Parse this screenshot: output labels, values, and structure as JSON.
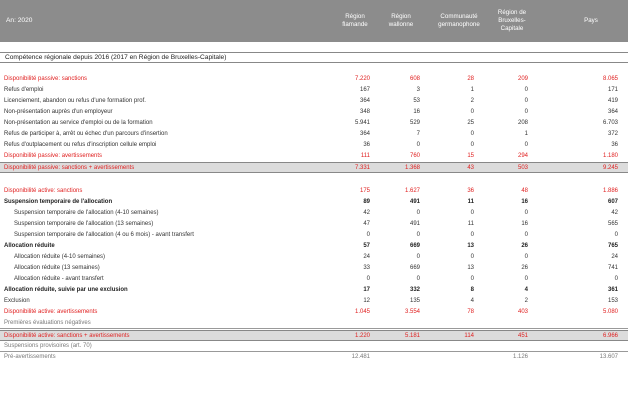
{
  "header": {
    "year_label": "An: 2020",
    "columns": [
      "Région\nflamande",
      "Région\nwallonne",
      "Communauté\ngermanophone",
      "Région de\nBruxelles-\nCapitale",
      "Pays"
    ]
  },
  "section_title": "Compétence régionale depuis 2016 (2017 en Région de Bruxelles-Capitale)",
  "rows": [
    {
      "label": "Disponibilité passive: sanctions",
      "vals": [
        "7.220",
        "608",
        "28",
        "209",
        "8.065"
      ],
      "style": "red"
    },
    {
      "label": "Refus d'emploi",
      "vals": [
        "167",
        "3",
        "1",
        "0",
        "171"
      ],
      "style": ""
    },
    {
      "label": "Licenciement, abandon ou refus d'une formation prof.",
      "vals": [
        "364",
        "53",
        "2",
        "0",
        "419"
      ],
      "style": ""
    },
    {
      "label": "Non-présentation auprès d'un employeur",
      "vals": [
        "348",
        "16",
        "0",
        "0",
        "364"
      ],
      "style": ""
    },
    {
      "label": "Non-présentation au service d'emploi ou de la formation",
      "vals": [
        "5.941",
        "529",
        "25",
        "208",
        "6.703"
      ],
      "style": ""
    },
    {
      "label": "Refus de participer à, arrêt ou échec d'un parcours d'insertion",
      "vals": [
        "364",
        "7",
        "0",
        "1",
        "372"
      ],
      "style": ""
    },
    {
      "label": "Refus d'outplacement ou refus d'inscription cellule emploi",
      "vals": [
        "36",
        "0",
        "0",
        "0",
        "36"
      ],
      "style": ""
    },
    {
      "label": "Disponibilité passive: avertissements",
      "vals": [
        "111",
        "760",
        "15",
        "294",
        "1.180"
      ],
      "style": "red"
    },
    {
      "label": "Disponibilité passive: sanctions + avertissements",
      "vals": [
        "7.331",
        "1.368",
        "43",
        "503",
        "9.245"
      ],
      "style": "total"
    },
    {
      "label": "Disponibilité active: sanctions",
      "vals": [
        "175",
        "1.627",
        "36",
        "48",
        "1.886"
      ],
      "style": "red"
    },
    {
      "label": "Suspension temporaire de l'allocation",
      "vals": [
        "89",
        "491",
        "11",
        "16",
        "607"
      ],
      "style": "bold"
    },
    {
      "label": "Suspension temporaire de l'allocation (4-10 semaines)",
      "vals": [
        "42",
        "0",
        "0",
        "0",
        "42"
      ],
      "style": "indent"
    },
    {
      "label": "Suspension temporaire de l'allocation (13 semaines)",
      "vals": [
        "47",
        "491",
        "11",
        "16",
        "565"
      ],
      "style": "indent"
    },
    {
      "label": "Suspension temporaire de l'allocation (4 ou 6 mois) - avant transfert",
      "vals": [
        "0",
        "0",
        "0",
        "0",
        "0"
      ],
      "style": "indent"
    },
    {
      "label": "Allocation réduite",
      "vals": [
        "57",
        "669",
        "13",
        "26",
        "765"
      ],
      "style": "bold"
    },
    {
      "label": "Allocation réduite (4-10 semaines)",
      "vals": [
        "24",
        "0",
        "0",
        "0",
        "24"
      ],
      "style": "indent"
    },
    {
      "label": "Allocation réduite (13 semaines)",
      "vals": [
        "33",
        "669",
        "13",
        "26",
        "741"
      ],
      "style": "indent"
    },
    {
      "label": "Allocation réduite - avant transfert",
      "vals": [
        "0",
        "0",
        "0",
        "0",
        "0"
      ],
      "style": "indent"
    },
    {
      "label": "Allocation réduite, suivie par une exclusion",
      "vals": [
        "17",
        "332",
        "8",
        "4",
        "361"
      ],
      "style": "bold"
    },
    {
      "label": "Exclusion",
      "vals": [
        "12",
        "135",
        "4",
        "2",
        "153"
      ],
      "style": ""
    },
    {
      "label": "Disponibilité active: avertissements",
      "vals": [
        "1.045",
        "3.554",
        "78",
        "403",
        "5.080"
      ],
      "style": "red"
    },
    {
      "label": "Premières évaluations négatives",
      "vals": [
        "",
        "",
        "",
        "",
        ""
      ],
      "style": "light sep"
    },
    {
      "label": "Disponibilité active: sanctions + avertissements",
      "vals": [
        "1.220",
        "5.181",
        "114",
        "451",
        "6.966"
      ],
      "style": "total"
    },
    {
      "label": "Suspensions provisoires (art. 70)",
      "vals": [
        "",
        "",
        "",
        "",
        ""
      ],
      "style": "light sep"
    },
    {
      "label": "Pré-avertissements",
      "vals": [
        "12.481",
        "",
        "",
        "1.126",
        "13.607"
      ],
      "style": "light"
    }
  ]
}
